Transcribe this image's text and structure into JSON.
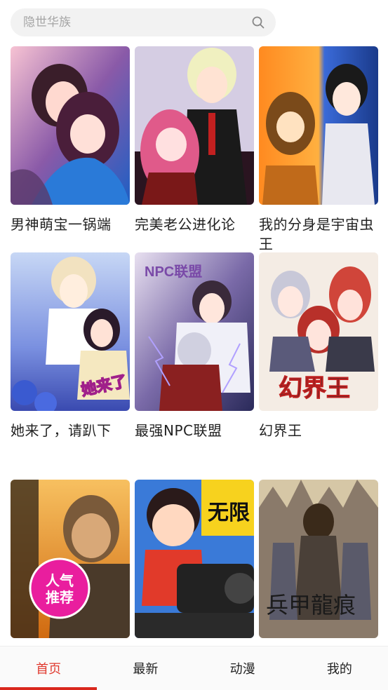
{
  "search": {
    "placeholder": "隐世华族"
  },
  "comics": [
    {
      "title": "男神萌宝一锅端",
      "colors": [
        "#f5b4c7",
        "#7a2d6b",
        "#1a67c7",
        "#ffd4da"
      ]
    },
    {
      "title": "完美老公进化论",
      "colors": [
        "#d8cfe5",
        "#8b1e1e",
        "#1a1a1a",
        "#f4aac4"
      ]
    },
    {
      "title": "我的分身是宇宙虫王",
      "colors": [
        "#ff7a1a",
        "#3a67d8",
        "#2a2a2a",
        "#f8e25a"
      ]
    },
    {
      "title": "她来了，请趴下",
      "colors": [
        "#8aa5e6",
        "#f7e8d8",
        "#3c3c8a",
        "#ffffff"
      ]
    },
    {
      "title": "最强NPC联盟",
      "colors": [
        "#5b4a8a",
        "#7a2a2a",
        "#a8a8c8",
        "#eae0f0"
      ]
    },
    {
      "title": "幻界王",
      "colors": [
        "#f2e7dd",
        "#d0453a",
        "#6a6a8a",
        "#2a2a2a"
      ]
    },
    {
      "title": "",
      "badge": "人气推荐",
      "colors": [
        "#f29a2a",
        "#4a3a2a",
        "#cfcfcf",
        "#e91e9e"
      ]
    },
    {
      "title": "",
      "badge_text": "无限",
      "colors": [
        "#3a7ad8",
        "#f7d21e",
        "#e13a2a",
        "#222222"
      ]
    },
    {
      "title": "",
      "colors": [
        "#c9b89a",
        "#3a3a3a",
        "#6a5a4a",
        "#eae0c8"
      ]
    }
  ],
  "tabbar": {
    "tabs": [
      {
        "label": "首页",
        "active": true
      },
      {
        "label": "最新",
        "active": false
      },
      {
        "label": "动漫",
        "active": false
      },
      {
        "label": "我的",
        "active": false
      }
    ]
  }
}
